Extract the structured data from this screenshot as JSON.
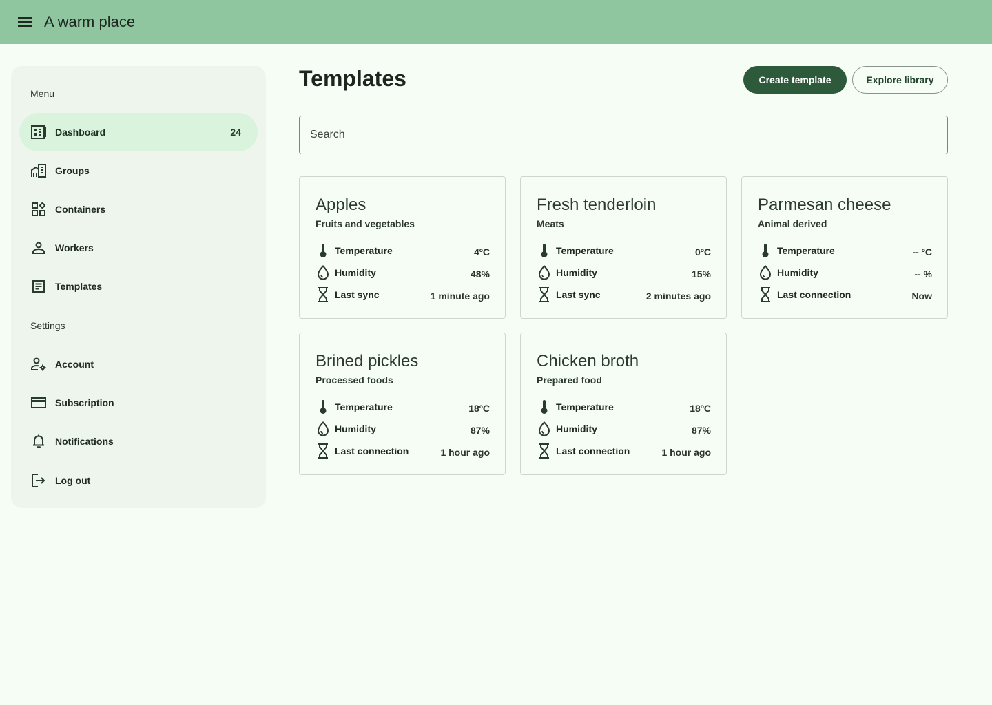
{
  "app": {
    "title": "A warm place"
  },
  "sidebar": {
    "menu_label": "Menu",
    "settings_label": "Settings",
    "menu_items": [
      {
        "label": "Dashboard",
        "icon": "dashboard-icon",
        "badge": "24",
        "active": true
      },
      {
        "label": "Groups",
        "icon": "groups-icon"
      },
      {
        "label": "Containers",
        "icon": "containers-icon"
      },
      {
        "label": "Workers",
        "icon": "person-icon"
      },
      {
        "label": "Templates",
        "icon": "templates-icon"
      }
    ],
    "settings_items": [
      {
        "label": "Account",
        "icon": "account-settings-icon"
      },
      {
        "label": "Subscription",
        "icon": "credit-card-icon"
      },
      {
        "label": "Notifications",
        "icon": "bell-icon"
      }
    ],
    "logout_label": "Log out"
  },
  "main": {
    "title": "Templates",
    "create_button": "Create template",
    "explore_button": "Explore library",
    "search_placeholder": "Search"
  },
  "cards": [
    {
      "title": "Apples",
      "subtitle": "Fruits and vegetables",
      "rows": [
        {
          "label": "Temperature",
          "value": "4ºC"
        },
        {
          "label": "Humidity",
          "value": "48%"
        },
        {
          "label": "Last sync",
          "value": "1 minute ago"
        }
      ]
    },
    {
      "title": "Fresh tenderloin",
      "subtitle": "Meats",
      "rows": [
        {
          "label": "Temperature",
          "value": "0ºC"
        },
        {
          "label": "Humidity",
          "value": "15%"
        },
        {
          "label": "Last sync",
          "value": "2 minutes ago"
        }
      ]
    },
    {
      "title": "Parmesan cheese",
      "subtitle": "Animal derived",
      "rows": [
        {
          "label": "Temperature",
          "value": "-- ºC"
        },
        {
          "label": "Humidity",
          "value": "-- %"
        },
        {
          "label": "Last connection",
          "value": "Now"
        }
      ]
    },
    {
      "title": "Brined pickles",
      "subtitle": "Processed foods",
      "rows": [
        {
          "label": "Temperature",
          "value": "18ºC"
        },
        {
          "label": "Humidity",
          "value": "87%"
        },
        {
          "label": "Last connection",
          "value": "1 hour ago"
        }
      ]
    },
    {
      "title": "Chicken broth",
      "subtitle": "Prepared food",
      "rows": [
        {
          "label": "Temperature",
          "value": "18ºC"
        },
        {
          "label": "Humidity",
          "value": "87%"
        },
        {
          "label": "Last connection",
          "value": "1 hour ago"
        }
      ]
    }
  ],
  "colors": {
    "topbar": "#8fc59f",
    "background": "#f6fdf4",
    "sidebar": "#eef5ec",
    "active_nav": "#d9f3dd",
    "primary_button": "#2d5a3a"
  }
}
